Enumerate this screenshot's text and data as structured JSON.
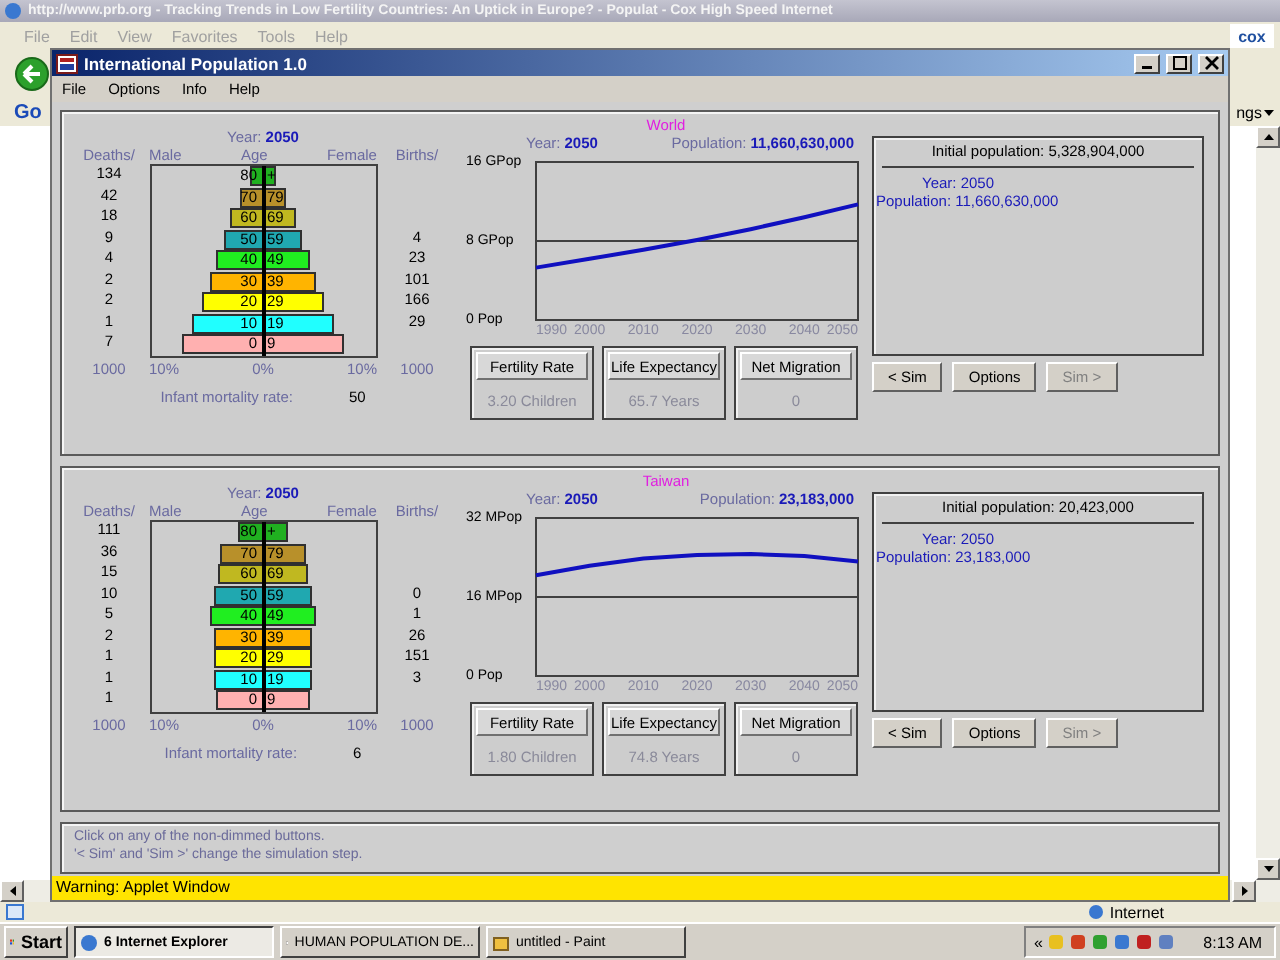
{
  "browser": {
    "title": "http://www.prb.org - Tracking Trends in Low Fertility Countries: An Uptick in Europe? - Populat - Cox High Speed Internet",
    "menu": [
      "File",
      "Edit",
      "View",
      "Favorites",
      "Tools",
      "Help"
    ],
    "logo": "cox",
    "links_logo": "Go",
    "links_fragment": "ngs",
    "status": "Internet"
  },
  "applet": {
    "title": "International Population 1.0",
    "menu": [
      "File",
      "Options",
      "Info",
      "Help"
    ],
    "regions": [
      {
        "title": "World",
        "year_label": "Year:",
        "year": "2050",
        "population_label": "Population:",
        "population": "11,660,630,000",
        "pyramid": {
          "year_label": "Year:",
          "year": "2050",
          "headers": [
            "Deaths/",
            "Male",
            "Age",
            "Female",
            "Births/"
          ],
          "rows": [
            {
              "age_low": "80",
              "age_high": "+",
              "deaths": "134",
              "color": "#20b020"
            },
            {
              "age_low": "70",
              "age_high": "79",
              "deaths": "42",
              "color": "#b8902a"
            },
            {
              "age_low": "60",
              "age_high": "69",
              "deaths": "18",
              "color": "#c0b820"
            },
            {
              "age_low": "50",
              "age_high": "59",
              "deaths": "9",
              "births": "4",
              "color": "#20a8b0"
            },
            {
              "age_low": "40",
              "age_high": "49",
              "deaths": "4",
              "births": "23",
              "color": "#20ee20"
            },
            {
              "age_low": "30",
              "age_high": "39",
              "deaths": "2",
              "births": "101",
              "color": "#ffb400"
            },
            {
              "age_low": "20",
              "age_high": "29",
              "deaths": "2",
              "births": "166",
              "color": "#ffff00"
            },
            {
              "age_low": "10",
              "age_high": "19",
              "deaths": "1",
              "births": "29",
              "color": "#20ffff"
            },
            {
              "age_low": "0",
              "age_high": "9",
              "deaths": "7",
              "color": "#ffb0b0"
            }
          ],
          "footer": [
            "1000",
            "10%",
            "0%",
            "10%",
            "1000"
          ],
          "infant_label": "Infant mortality rate:",
          "infant_value": "50"
        },
        "chart_data": {
          "type": "line",
          "x": [
            1990,
            2000,
            2010,
            2020,
            2030,
            2040,
            2050
          ],
          "series": [
            {
              "color": "#1010c0",
              "values": [
                5.3,
                6.2,
                7.1,
                8.1,
                9.2,
                10.4,
                11.7
              ]
            }
          ],
          "xlim": [
            1990,
            2050
          ],
          "ylim": [
            0,
            16
          ],
          "xticks": [
            1990,
            2000,
            2010,
            2020,
            2030,
            2040,
            2050
          ],
          "yticks": [
            {
              "value": 0,
              "label": "0 Pop"
            },
            {
              "value": 8,
              "label": "8 GPop"
            },
            {
              "value": 16,
              "label": "16 GPop"
            }
          ]
        },
        "params": [
          {
            "label": "Fertility Rate",
            "value": "3.20 Children"
          },
          {
            "label": "Life Expectancy",
            "value": "65.7 Years"
          },
          {
            "label": "Net Migration",
            "value": "0"
          }
        ],
        "info": {
          "initial": "Initial population: 5,328,904,000",
          "year": "Year: 2050",
          "population": "Population: 11,660,630,000"
        },
        "buttons": [
          {
            "label": "< Sim",
            "disabled": false
          },
          {
            "label": "Options",
            "disabled": false
          },
          {
            "label": "Sim >",
            "disabled": true
          }
        ]
      },
      {
        "title": "Taiwan",
        "year_label": "Year:",
        "year": "2050",
        "population_label": "Population:",
        "population": "23,183,000",
        "pyramid": {
          "year_label": "Year:",
          "year": "2050",
          "headers": [
            "Deaths/",
            "Male",
            "Age",
            "Female",
            "Births/"
          ],
          "rows": [
            {
              "age_low": "80",
              "age_high": "+",
              "deaths": "111",
              "color": "#20b020"
            },
            {
              "age_low": "70",
              "age_high": "79",
              "deaths": "36",
              "color": "#b8902a"
            },
            {
              "age_low": "60",
              "age_high": "69",
              "deaths": "15",
              "color": "#c0b820"
            },
            {
              "age_low": "50",
              "age_high": "59",
              "deaths": "10",
              "births": "0",
              "color": "#20a8b0"
            },
            {
              "age_low": "40",
              "age_high": "49",
              "deaths": "5",
              "births": "1",
              "color": "#20ee20"
            },
            {
              "age_low": "30",
              "age_high": "39",
              "deaths": "2",
              "births": "26",
              "color": "#ffb400"
            },
            {
              "age_low": "20",
              "age_high": "29",
              "deaths": "1",
              "births": "151",
              "color": "#ffff00"
            },
            {
              "age_low": "10",
              "age_high": "19",
              "deaths": "1",
              "births": "3",
              "color": "#20ffff"
            },
            {
              "age_low": "0",
              "age_high": "9",
              "deaths": "1",
              "color": "#ffb0b0"
            }
          ],
          "footer": [
            "1000",
            "10%",
            "0%",
            "10%",
            "1000"
          ],
          "infant_label": "Infant mortality rate:",
          "infant_value": "6"
        },
        "chart_data": {
          "type": "line",
          "x": [
            1990,
            2000,
            2010,
            2020,
            2030,
            2040,
            2050
          ],
          "series": [
            {
              "color": "#1010c0",
              "values": [
                20.4,
                22.3,
                23.8,
                24.5,
                24.7,
                24.3,
                23.2
              ]
            }
          ],
          "xlim": [
            1990,
            2050
          ],
          "ylim": [
            0,
            32
          ],
          "xticks": [
            1990,
            2000,
            2010,
            2020,
            2030,
            2040,
            2050
          ],
          "yticks": [
            {
              "value": 0,
              "label": "0 Pop"
            },
            {
              "value": 16,
              "label": "16 MPop"
            },
            {
              "value": 32,
              "label": "32 MPop"
            }
          ]
        },
        "params": [
          {
            "label": "Fertility Rate",
            "value": "1.80 Children"
          },
          {
            "label": "Life Expectancy",
            "value": "74.8 Years"
          },
          {
            "label": "Net Migration",
            "value": "0"
          }
        ],
        "info": {
          "initial": "Initial population: 20,423,000",
          "year": "Year: 2050",
          "population": "Population: 23,183,000"
        },
        "buttons": [
          {
            "label": "< Sim",
            "disabled": false
          },
          {
            "label": "Options",
            "disabled": false
          },
          {
            "label": "Sim >",
            "disabled": true
          }
        ]
      }
    ],
    "status_lines": [
      "Click on any of the non-dimmed buttons.",
      "'< Sim' and 'Sim >' change the simulation step."
    ],
    "warning": "Warning: Applet Window"
  },
  "taskbar": {
    "start": "Start",
    "tasks": [
      {
        "label": "6 Internet Explorer",
        "selected": true
      },
      {
        "label": "HUMAN POPULATION DE...",
        "selected": false
      },
      {
        "label": "untitled - Paint",
        "selected": false
      }
    ],
    "tray_expand": "«",
    "clock": "8:13 AM"
  }
}
